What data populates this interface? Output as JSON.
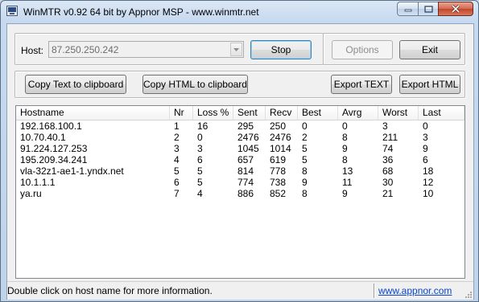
{
  "window": {
    "title": "WinMTR v0.92 64 bit by Appnor MSP - www.winmtr.net",
    "icon": "winmtr-app-icon",
    "caption_buttons": [
      "minimize-icon",
      "maximize-icon",
      "close-icon"
    ]
  },
  "host": {
    "label": "Host:",
    "value": "87.250.250.242",
    "stop_label": "Stop"
  },
  "options_label": "Options",
  "exit_label": "Exit",
  "toolbar": {
    "copy_text": "Copy Text to clipboard",
    "copy_html": "Copy HTML to clipboard",
    "export_text": "Export TEXT",
    "export_html": "Export HTML"
  },
  "table": {
    "columns": [
      "Hostname",
      "Nr",
      "Loss %",
      "Sent",
      "Recv",
      "Best",
      "Avrg",
      "Worst",
      "Last"
    ],
    "rows": [
      [
        "192.168.100.1",
        "1",
        "16",
        "295",
        "250",
        "0",
        "0",
        "3",
        "0"
      ],
      [
        "10.70.40.1",
        "2",
        "0",
        "2476",
        "2476",
        "2",
        "8",
        "211",
        "3"
      ],
      [
        "91.224.127.253",
        "3",
        "3",
        "1045",
        "1014",
        "5",
        "9",
        "74",
        "9"
      ],
      [
        "195.209.34.241",
        "4",
        "6",
        "657",
        "619",
        "5",
        "8",
        "36",
        "6"
      ],
      [
        "vla-32z1-ae1-1.yndx.net",
        "5",
        "5",
        "814",
        "778",
        "8",
        "13",
        "68",
        "18"
      ],
      [
        "10.1.1.1",
        "6",
        "5",
        "774",
        "738",
        "9",
        "11",
        "30",
        "12"
      ],
      [
        "ya.ru",
        "7",
        "4",
        "886",
        "852",
        "8",
        "9",
        "21",
        "10"
      ]
    ]
  },
  "status": {
    "text": "Double click on host name for more information.",
    "link": "www.appnor.com"
  },
  "colors": {
    "close_button": "#c8462c",
    "link": "#0a46c8",
    "title_bg": "#c6d9ef"
  }
}
